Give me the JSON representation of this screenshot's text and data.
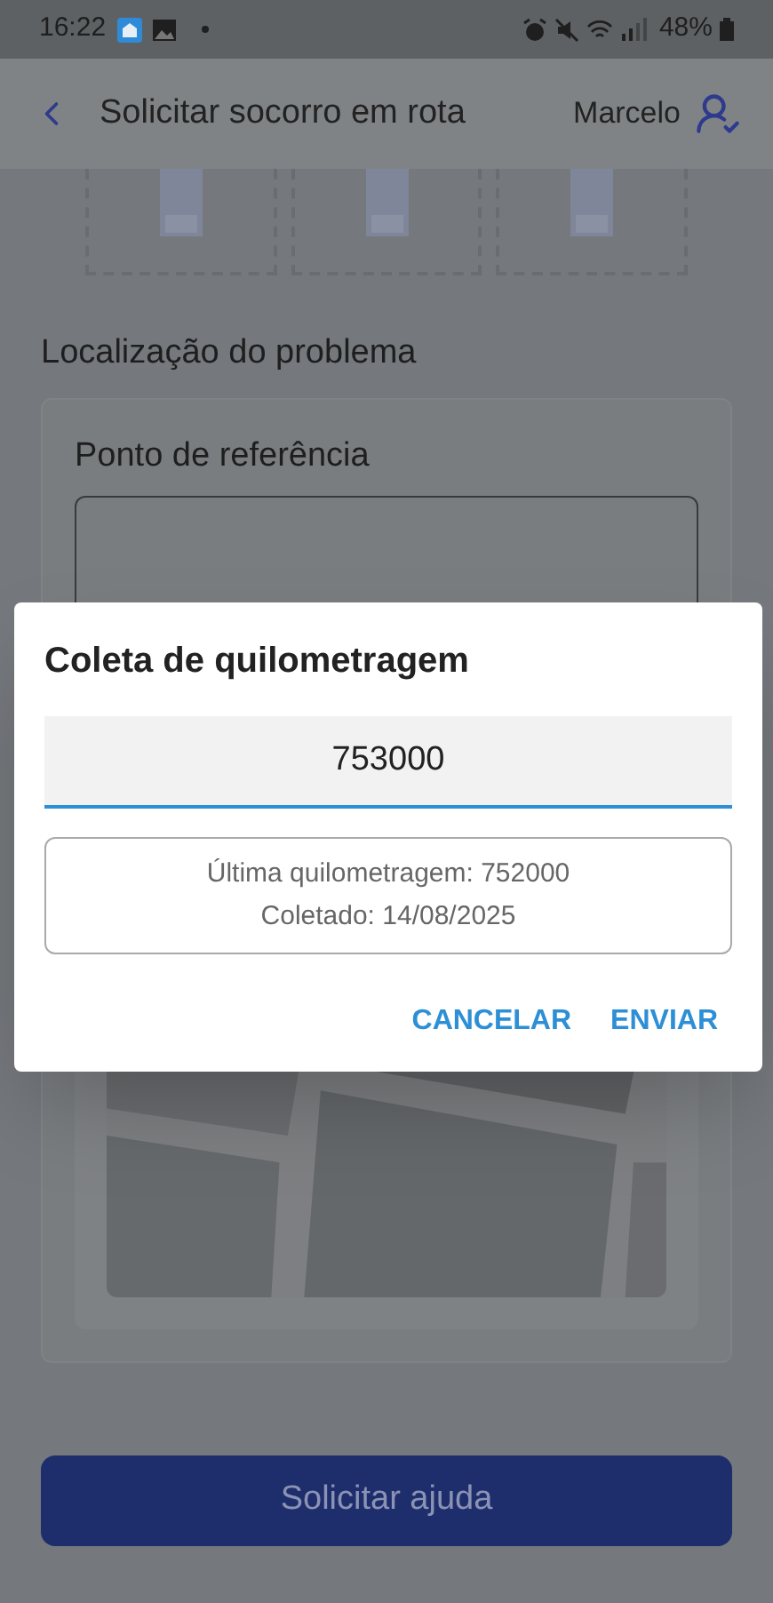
{
  "status_bar": {
    "time": "16:22",
    "battery": "48%"
  },
  "app_bar": {
    "title": "Solicitar socorro em rota",
    "user_name": "Marcelo"
  },
  "photo_slots": [
    {
      "kind": "empty"
    },
    {
      "kind": "empty"
    },
    {
      "kind": "empty"
    }
  ],
  "location": {
    "heading": "Localização do problema",
    "reference_label": "Ponto de referência"
  },
  "submit_button": {
    "label": "Solicitar ajuda"
  },
  "dialog": {
    "title": "Coleta de quilometragem",
    "input": {
      "value": "753000"
    },
    "info_lines": [
      "Última quilometragem: 752000",
      "Coletado: 14/08/2025"
    ],
    "buttons": [
      "CANCELAR",
      "ENVIAR"
    ]
  }
}
